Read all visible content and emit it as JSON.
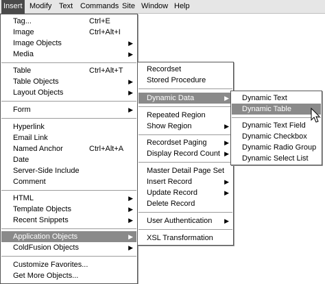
{
  "menubar": {
    "items": [
      "Insert",
      "Modify",
      "Text",
      "Commands",
      "Site",
      "Window",
      "Help"
    ],
    "active": "Insert"
  },
  "insert_menu": {
    "items": [
      {
        "label": "Tag...",
        "shortcut": "Ctrl+E"
      },
      {
        "label": "Image",
        "shortcut": "Ctrl+Alt+I"
      },
      {
        "label": "Image Objects",
        "submenu": true
      },
      {
        "label": "Media",
        "submenu": true
      },
      {
        "label": "Table",
        "shortcut": "Ctrl+Alt+T"
      },
      {
        "label": "Table Objects",
        "submenu": true
      },
      {
        "label": "Layout Objects",
        "submenu": true
      },
      {
        "label": "Form",
        "submenu": true
      },
      {
        "label": "Hyperlink"
      },
      {
        "label": "Email Link"
      },
      {
        "label": "Named Anchor",
        "shortcut": "Ctrl+Alt+A"
      },
      {
        "label": "Date"
      },
      {
        "label": "Server-Side Include"
      },
      {
        "label": "Comment"
      },
      {
        "label": "HTML",
        "submenu": true
      },
      {
        "label": "Template Objects",
        "submenu": true
      },
      {
        "label": "Recent Snippets",
        "submenu": true
      },
      {
        "label": "Application Objects",
        "submenu": true,
        "highlighted": true
      },
      {
        "label": "ColdFusion Objects",
        "submenu": true
      },
      {
        "label": "Customize Favorites..."
      },
      {
        "label": "Get More Objects..."
      }
    ]
  },
  "application_objects_menu": {
    "items": [
      {
        "label": "Recordset"
      },
      {
        "label": "Stored Procedure"
      },
      {
        "label": "Dynamic Data",
        "submenu": true,
        "highlighted": true
      },
      {
        "label": "Repeated Region"
      },
      {
        "label": "Show Region",
        "submenu": true
      },
      {
        "label": "Recordset Paging",
        "submenu": true
      },
      {
        "label": "Display Record Count",
        "submenu": true
      },
      {
        "label": "Master Detail Page Set"
      },
      {
        "label": "Insert Record",
        "submenu": true
      },
      {
        "label": "Update Record",
        "submenu": true
      },
      {
        "label": "Delete Record"
      },
      {
        "label": "User Authentication",
        "submenu": true
      },
      {
        "label": "XSL Transformation"
      }
    ]
  },
  "dynamic_data_menu": {
    "items": [
      {
        "label": "Dynamic Text"
      },
      {
        "label": "Dynamic Table",
        "highlighted": true
      },
      {
        "label": "Dynamic Text Field"
      },
      {
        "label": "Dynamic Checkbox"
      },
      {
        "label": "Dynamic Radio Group"
      },
      {
        "label": "Dynamic Select List"
      }
    ]
  },
  "icons": {
    "submenu_arrow": "submenu-arrow-icon",
    "cursor": "mouse-pointer-icon"
  },
  "colors": {
    "menubar_bg": "#e6e6e6",
    "active_menu_bg": "#4a4a4a",
    "highlight_bg": "#8a8a8a",
    "menu_bg": "#ffffff"
  }
}
